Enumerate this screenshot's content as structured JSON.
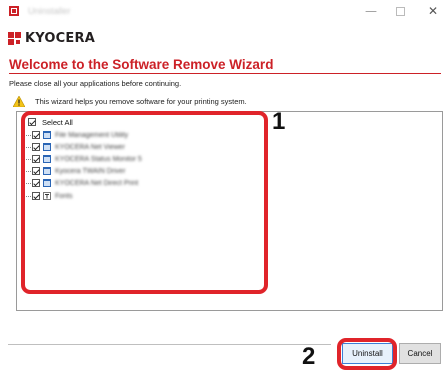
{
  "window": {
    "title": "Uninstaller",
    "controls": {
      "minimize": "—",
      "maximize": "",
      "close": "✕"
    }
  },
  "brand": {
    "logo_text": "KYOCERA"
  },
  "wizard": {
    "heading": "Welcome to the Software Remove Wizard",
    "instruction": "Please close all your applications before continuing.",
    "info": "This wizard helps you remove software for your printing system."
  },
  "software_list": {
    "select_all_label": "Select All",
    "select_all_checked": true,
    "items": [
      {
        "label": "File Management Utility",
        "checked": true,
        "icon": "application-icon"
      },
      {
        "label": "KYOCERA Net Viewer",
        "checked": true,
        "icon": "application-icon"
      },
      {
        "label": "KYOCERA Status Monitor 5",
        "checked": true,
        "icon": "application-icon"
      },
      {
        "label": "Kyocera TWAIN Driver",
        "checked": true,
        "icon": "application-icon"
      },
      {
        "label": "KYOCERA Net Direct Print",
        "checked": true,
        "icon": "application-icon"
      },
      {
        "label": "Fonts",
        "checked": true,
        "icon": "font-icon"
      }
    ]
  },
  "callouts": [
    {
      "number": "1",
      "target": "software-list"
    },
    {
      "number": "2",
      "target": "uninstall-button"
    }
  ],
  "buttons": {
    "uninstall": "Uninstall",
    "cancel": "Cancel"
  },
  "colors": {
    "brand_red": "#cc2127",
    "callout_red": "#e0242a",
    "primary_button_border": "#3c7fd6"
  }
}
